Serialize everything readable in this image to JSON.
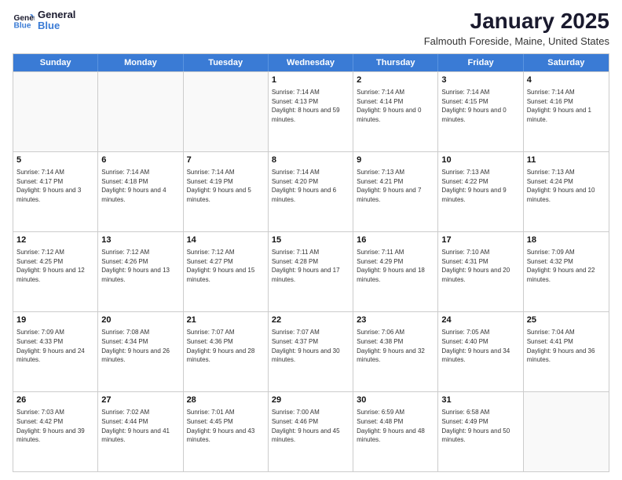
{
  "header": {
    "logo_line1": "General",
    "logo_line2": "Blue",
    "month": "January 2025",
    "location": "Falmouth Foreside, Maine, United States"
  },
  "weekdays": [
    "Sunday",
    "Monday",
    "Tuesday",
    "Wednesday",
    "Thursday",
    "Friday",
    "Saturday"
  ],
  "rows": [
    [
      {
        "day": "",
        "info": ""
      },
      {
        "day": "",
        "info": ""
      },
      {
        "day": "",
        "info": ""
      },
      {
        "day": "1",
        "info": "Sunrise: 7:14 AM\nSunset: 4:13 PM\nDaylight: 8 hours and 59 minutes."
      },
      {
        "day": "2",
        "info": "Sunrise: 7:14 AM\nSunset: 4:14 PM\nDaylight: 9 hours and 0 minutes."
      },
      {
        "day": "3",
        "info": "Sunrise: 7:14 AM\nSunset: 4:15 PM\nDaylight: 9 hours and 0 minutes."
      },
      {
        "day": "4",
        "info": "Sunrise: 7:14 AM\nSunset: 4:16 PM\nDaylight: 9 hours and 1 minute."
      }
    ],
    [
      {
        "day": "5",
        "info": "Sunrise: 7:14 AM\nSunset: 4:17 PM\nDaylight: 9 hours and 3 minutes."
      },
      {
        "day": "6",
        "info": "Sunrise: 7:14 AM\nSunset: 4:18 PM\nDaylight: 9 hours and 4 minutes."
      },
      {
        "day": "7",
        "info": "Sunrise: 7:14 AM\nSunset: 4:19 PM\nDaylight: 9 hours and 5 minutes."
      },
      {
        "day": "8",
        "info": "Sunrise: 7:14 AM\nSunset: 4:20 PM\nDaylight: 9 hours and 6 minutes."
      },
      {
        "day": "9",
        "info": "Sunrise: 7:13 AM\nSunset: 4:21 PM\nDaylight: 9 hours and 7 minutes."
      },
      {
        "day": "10",
        "info": "Sunrise: 7:13 AM\nSunset: 4:22 PM\nDaylight: 9 hours and 9 minutes."
      },
      {
        "day": "11",
        "info": "Sunrise: 7:13 AM\nSunset: 4:24 PM\nDaylight: 9 hours and 10 minutes."
      }
    ],
    [
      {
        "day": "12",
        "info": "Sunrise: 7:12 AM\nSunset: 4:25 PM\nDaylight: 9 hours and 12 minutes."
      },
      {
        "day": "13",
        "info": "Sunrise: 7:12 AM\nSunset: 4:26 PM\nDaylight: 9 hours and 13 minutes."
      },
      {
        "day": "14",
        "info": "Sunrise: 7:12 AM\nSunset: 4:27 PM\nDaylight: 9 hours and 15 minutes."
      },
      {
        "day": "15",
        "info": "Sunrise: 7:11 AM\nSunset: 4:28 PM\nDaylight: 9 hours and 17 minutes."
      },
      {
        "day": "16",
        "info": "Sunrise: 7:11 AM\nSunset: 4:29 PM\nDaylight: 9 hours and 18 minutes."
      },
      {
        "day": "17",
        "info": "Sunrise: 7:10 AM\nSunset: 4:31 PM\nDaylight: 9 hours and 20 minutes."
      },
      {
        "day": "18",
        "info": "Sunrise: 7:09 AM\nSunset: 4:32 PM\nDaylight: 9 hours and 22 minutes."
      }
    ],
    [
      {
        "day": "19",
        "info": "Sunrise: 7:09 AM\nSunset: 4:33 PM\nDaylight: 9 hours and 24 minutes."
      },
      {
        "day": "20",
        "info": "Sunrise: 7:08 AM\nSunset: 4:34 PM\nDaylight: 9 hours and 26 minutes."
      },
      {
        "day": "21",
        "info": "Sunrise: 7:07 AM\nSunset: 4:36 PM\nDaylight: 9 hours and 28 minutes."
      },
      {
        "day": "22",
        "info": "Sunrise: 7:07 AM\nSunset: 4:37 PM\nDaylight: 9 hours and 30 minutes."
      },
      {
        "day": "23",
        "info": "Sunrise: 7:06 AM\nSunset: 4:38 PM\nDaylight: 9 hours and 32 minutes."
      },
      {
        "day": "24",
        "info": "Sunrise: 7:05 AM\nSunset: 4:40 PM\nDaylight: 9 hours and 34 minutes."
      },
      {
        "day": "25",
        "info": "Sunrise: 7:04 AM\nSunset: 4:41 PM\nDaylight: 9 hours and 36 minutes."
      }
    ],
    [
      {
        "day": "26",
        "info": "Sunrise: 7:03 AM\nSunset: 4:42 PM\nDaylight: 9 hours and 39 minutes."
      },
      {
        "day": "27",
        "info": "Sunrise: 7:02 AM\nSunset: 4:44 PM\nDaylight: 9 hours and 41 minutes."
      },
      {
        "day": "28",
        "info": "Sunrise: 7:01 AM\nSunset: 4:45 PM\nDaylight: 9 hours and 43 minutes."
      },
      {
        "day": "29",
        "info": "Sunrise: 7:00 AM\nSunset: 4:46 PM\nDaylight: 9 hours and 45 minutes."
      },
      {
        "day": "30",
        "info": "Sunrise: 6:59 AM\nSunset: 4:48 PM\nDaylight: 9 hours and 48 minutes."
      },
      {
        "day": "31",
        "info": "Sunrise: 6:58 AM\nSunset: 4:49 PM\nDaylight: 9 hours and 50 minutes."
      },
      {
        "day": "",
        "info": ""
      }
    ]
  ]
}
